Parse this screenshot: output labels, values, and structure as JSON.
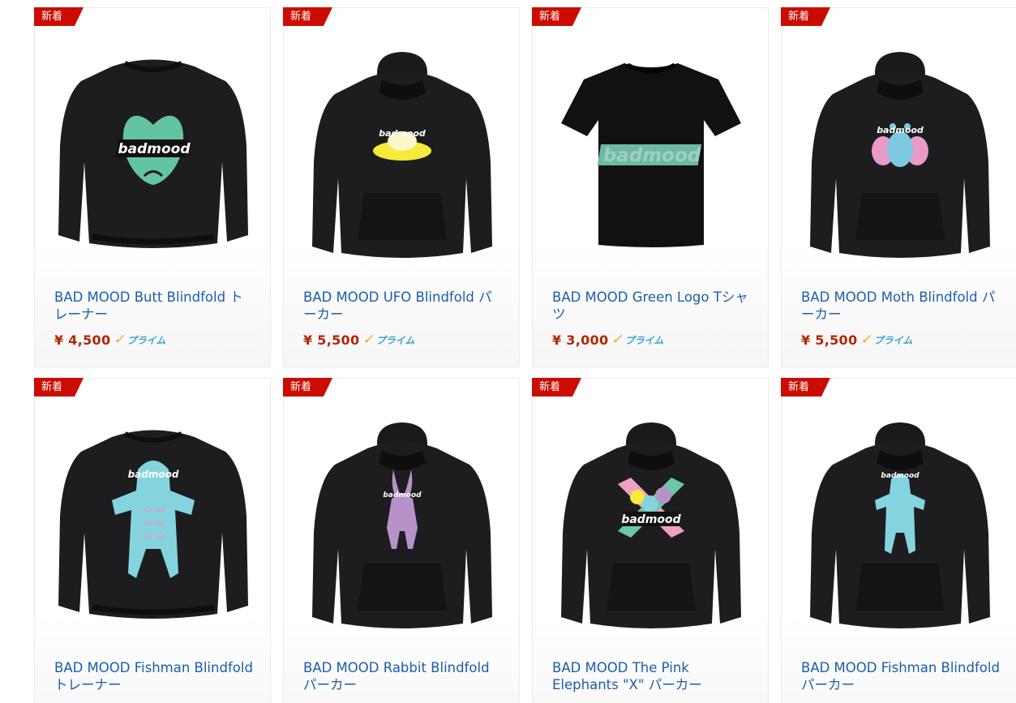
{
  "new_badge_label": "新着",
  "prime_label": "プライム",
  "colors": {
    "badge": "#cc0c00",
    "title_link": "#1b5eab",
    "price": "#b12704",
    "prime_check": "#f0a31c",
    "prime_text": "#3ba3d6"
  },
  "products": [
    {
      "title": "BAD MOOD Butt Blindfold トレーナー",
      "price": "¥ 4,500",
      "garment": "sweatshirt",
      "graphic": "green-heart-badmood"
    },
    {
      "title": "BAD MOOD UFO Blindfold パーカー",
      "price": "¥ 5,500",
      "garment": "hoodie",
      "graphic": "yellow-ufo-badmood"
    },
    {
      "title": "BAD MOOD Green Logo Tシャツ",
      "price": "¥ 3,000",
      "garment": "tshirt",
      "graphic": "green-badmood-logo"
    },
    {
      "title": "BAD MOOD Moth Blindfold パーカー",
      "price": "¥ 5,500",
      "garment": "hoodie",
      "graphic": "blue-moth-badmood"
    },
    {
      "title": "BAD MOOD Fishman Blindfold トレーナー",
      "garment": "sweatshirt",
      "graphic": "blue-fishman-badmood"
    },
    {
      "title": "BAD MOOD Rabbit Blindfold パーカー",
      "garment": "hoodie",
      "graphic": "purple-rabbit-badmood"
    },
    {
      "title": "BAD MOOD The Pink Elephants \"X\" パーカー",
      "garment": "hoodie",
      "graphic": "pink-x-elephants-badmood"
    },
    {
      "title": "BAD MOOD Fishman Blindfold パーカー",
      "garment": "hoodie",
      "graphic": "blue-fishman-badmood"
    }
  ]
}
